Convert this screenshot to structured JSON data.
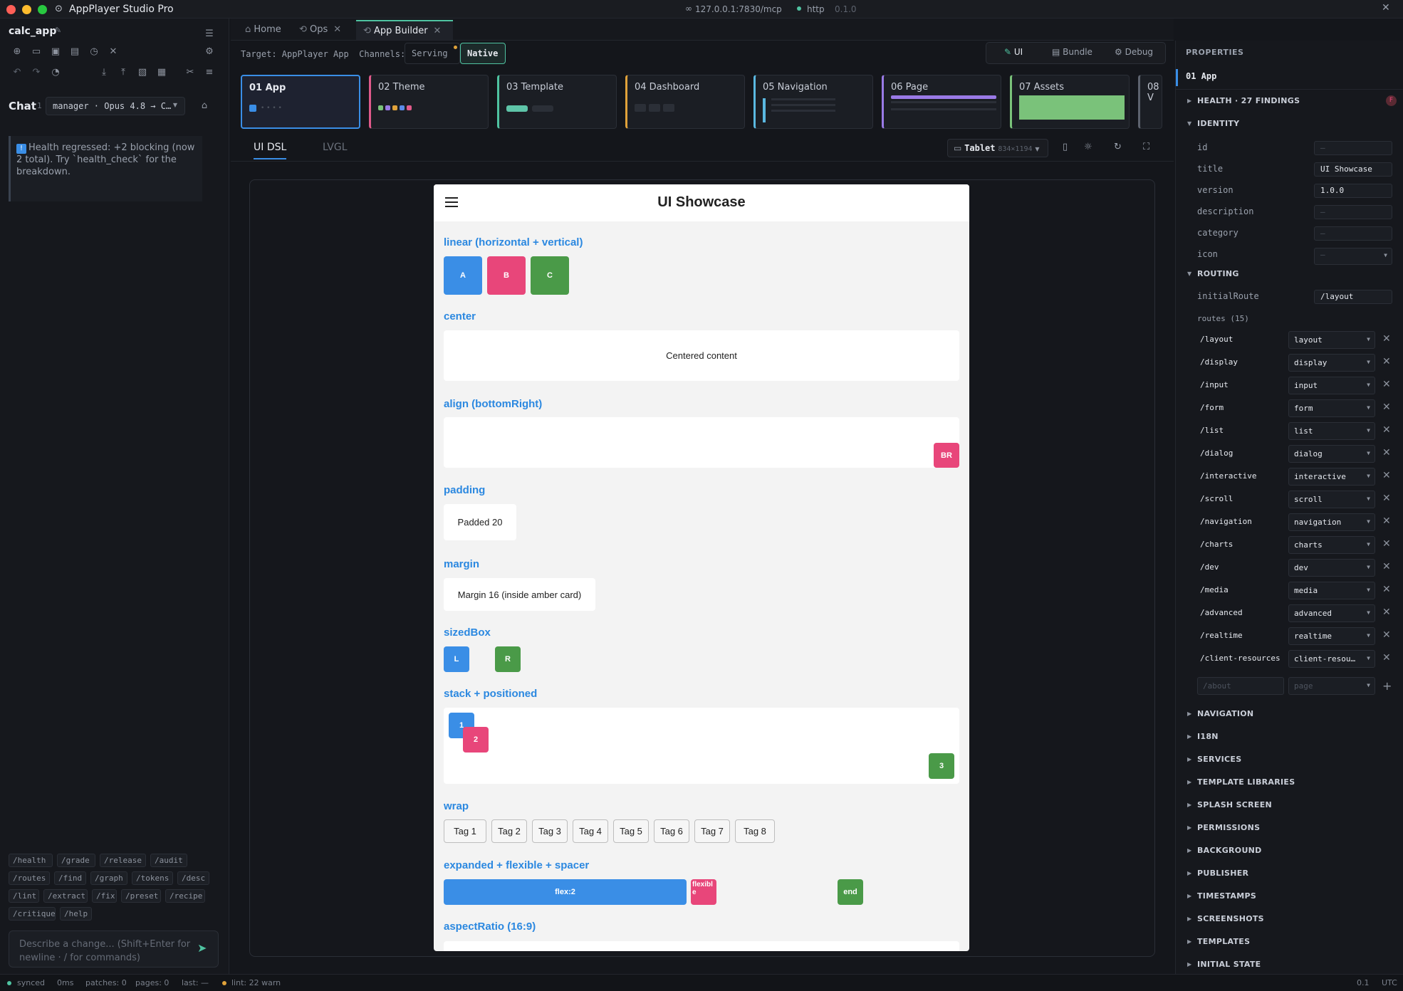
{
  "window": {
    "title": "AppPlayer Studio Pro",
    "url": "127.0.0.1:7830/mcp",
    "protocol": "http",
    "version": "0.1.0"
  },
  "left": {
    "project": "calc_app",
    "chat_label": "Chat",
    "chat_count": "1",
    "model": "manager · Opus 4.8 → C…",
    "message": "Health regressed: +2 blocking (now 2 total). Try `health_check` for the breakdown.",
    "commands": [
      "/health",
      "/grade",
      "/release",
      "/audit",
      "/routes",
      "/find",
      "/graph",
      "/tokens",
      "/desc",
      "/lint",
      "/extract",
      "/fix",
      "/preset",
      "/recipe",
      "/critique",
      "/help"
    ],
    "input_placeholder": "Describe a change... (Shift+Enter for newline · / for commands)"
  },
  "tabs": [
    {
      "label": "Home"
    },
    {
      "label": "Ops"
    },
    {
      "label": "App Builder"
    }
  ],
  "toolbar": {
    "target": "Target: AppPlayer App",
    "channels_label": "Channels:",
    "serving": "Serving",
    "native": "Native",
    "modes": [
      "UI",
      "Bundle",
      "Debug"
    ]
  },
  "sections": [
    "01 App",
    "02 Theme",
    "03 Template",
    "04 Dashboard",
    "05 Navigation",
    "06 Page",
    "07 Assets",
    "08 V"
  ],
  "section_colors": [
    "#3a8ee6",
    "#e05a8a",
    "#4fc3a1",
    "#e0a23a",
    "#5ab8e0",
    "#9a7ae6",
    "#7ac27a",
    "#5d636e"
  ],
  "subtabs": [
    "UI DSL",
    "LVGL"
  ],
  "device": {
    "label": "Tablet",
    "dims": "834×1194"
  },
  "preview": {
    "title": "UI Showcase",
    "sections": {
      "linear": "linear (horizontal + vertical)",
      "center": "center",
      "align": "align (bottomRight)",
      "padding": "padding",
      "margin": "margin",
      "sizedbox": "sizedBox",
      "stack": "stack + positioned",
      "wrap": "wrap",
      "expanded": "expanded + flexible + spacer",
      "aspect": "aspectRatio (16:9)"
    },
    "linear_boxes": [
      "A",
      "B",
      "C"
    ],
    "centered": "Centered content",
    "br": "BR",
    "padded": "Padded 20",
    "margined": "Margin 16 (inside amber card)",
    "sized": [
      "L",
      "R"
    ],
    "stack": [
      "1",
      "2",
      "3"
    ],
    "tags": [
      "Tag 1",
      "Tag 2",
      "Tag 3",
      "Tag 4",
      "Tag 5",
      "Tag 6",
      "Tag 7",
      "Tag 8"
    ],
    "flex2": "flex:2",
    "flexible": "flexible",
    "end": "end"
  },
  "props": {
    "header": "PROPERTIES",
    "selected": "01 App",
    "health": "HEALTH · 27 FINDINGS",
    "health_badge": "F",
    "identity": "IDENTITY",
    "fields": [
      {
        "label": "id",
        "value": "—"
      },
      {
        "label": "title",
        "value": "UI Showcase"
      },
      {
        "label": "version",
        "value": "1.0.0"
      },
      {
        "label": "description",
        "value": "—"
      },
      {
        "label": "category",
        "value": "—"
      },
      {
        "label": "icon",
        "value": "—"
      }
    ],
    "routing": "ROUTING",
    "initial_route_label": "initialRoute",
    "initial_route": "/layout",
    "routes_label": "routes (15)",
    "routes": [
      [
        "/layout",
        "layout"
      ],
      [
        "/display",
        "display"
      ],
      [
        "/input",
        "input"
      ],
      [
        "/form",
        "form"
      ],
      [
        "/list",
        "list"
      ],
      [
        "/dialog",
        "dialog"
      ],
      [
        "/interactive",
        "interactive"
      ],
      [
        "/scroll",
        "scroll"
      ],
      [
        "/navigation",
        "navigation"
      ],
      [
        "/charts",
        "charts"
      ],
      [
        "/dev",
        "dev"
      ],
      [
        "/media",
        "media"
      ],
      [
        "/advanced",
        "advanced"
      ],
      [
        "/realtime",
        "realtime"
      ],
      [
        "/client-resources",
        "client-resou…"
      ]
    ],
    "new_route_placeholder": "/about",
    "new_page_placeholder": "page",
    "collapsed": [
      "NAVIGATION",
      "I18N",
      "SERVICES",
      "TEMPLATE LIBRARIES",
      "SPLASH SCREEN",
      "PERMISSIONS",
      "BACKGROUND",
      "PUBLISHER",
      "TIMESTAMPS",
      "SCREENSHOTS",
      "TEMPLATES",
      "INITIAL STATE"
    ]
  },
  "status": {
    "synced": "synced",
    "latency": "0ms",
    "patches": "patches: 0",
    "pages": "pages: 0",
    "last": "last: —",
    "lint": "lint: 22 warn",
    "right1": "0.1",
    "right2": "UTC"
  }
}
